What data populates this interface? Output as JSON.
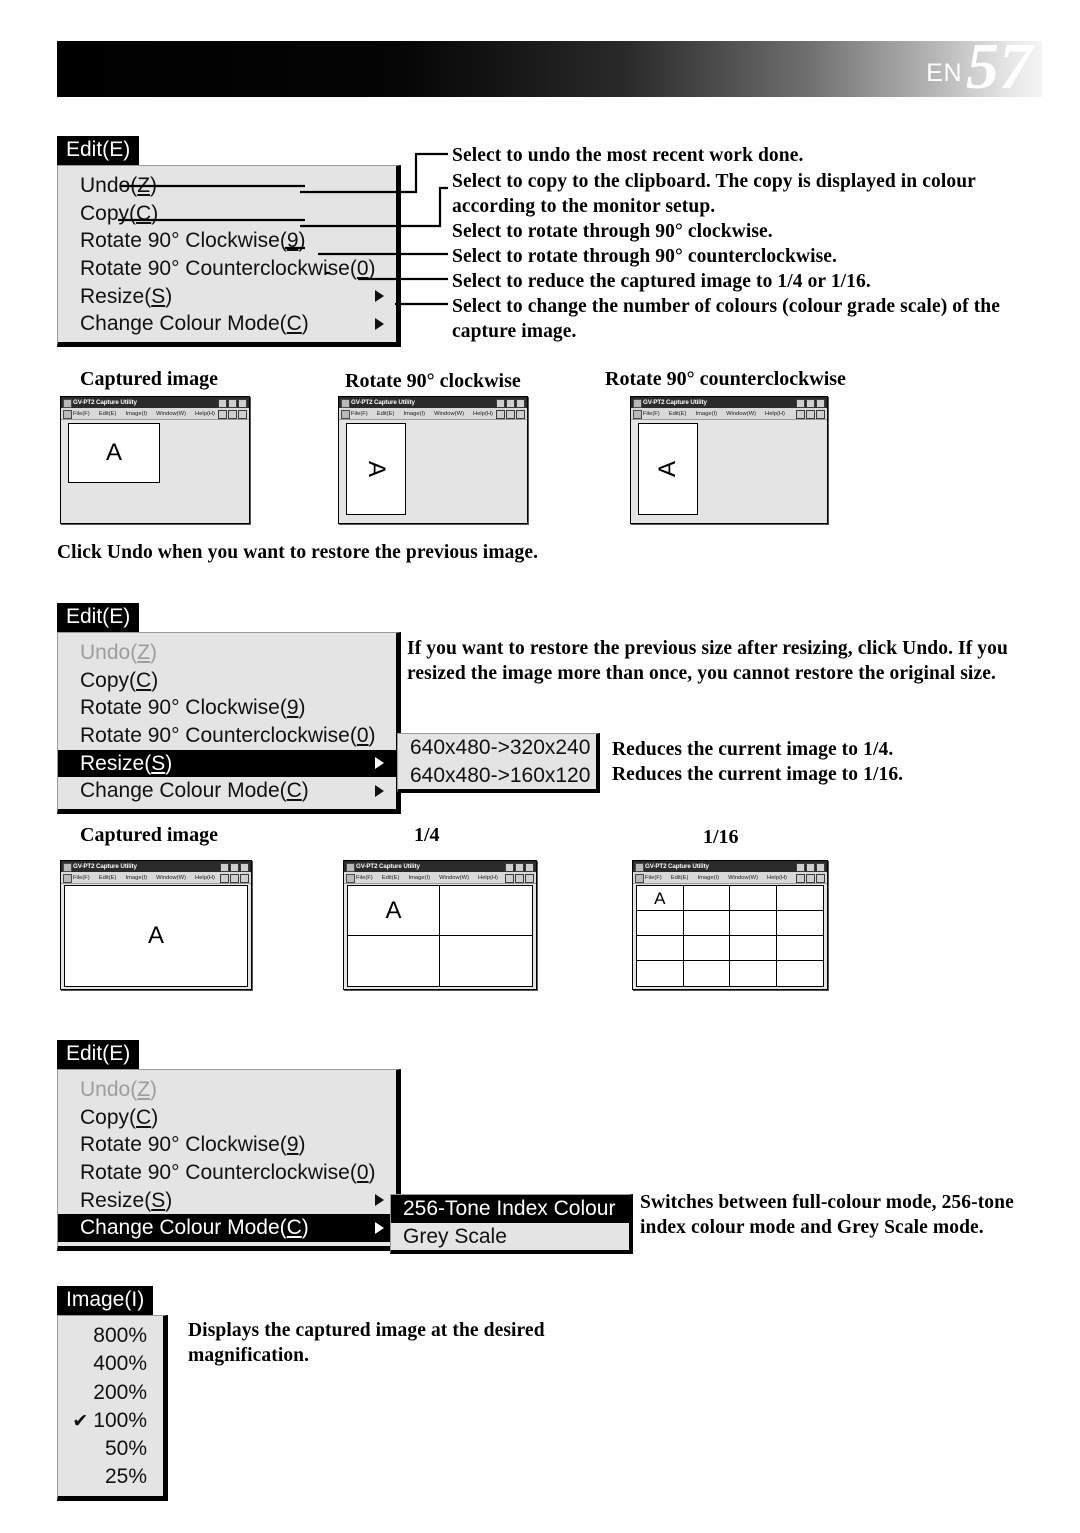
{
  "header": {
    "lang": "EN",
    "page_number": "57"
  },
  "menu1": {
    "title": "Edit(E)",
    "title_mnemonic": "E",
    "items": [
      {
        "label": "Undo(Z)",
        "mnemonic": "Z",
        "disabled": false,
        "selected": false,
        "submenu_arrow": false
      },
      {
        "label": "Copy(C)",
        "mnemonic": "C",
        "disabled": false,
        "selected": false,
        "submenu_arrow": false
      },
      {
        "label": "Rotate 90° Clockwise(9)",
        "mnemonic": "9",
        "disabled": false,
        "selected": false,
        "submenu_arrow": false
      },
      {
        "label": "Rotate 90° Counterclockwise(0)",
        "mnemonic": "0",
        "disabled": false,
        "selected": false,
        "submenu_arrow": false
      },
      {
        "label": "Resize(S)",
        "mnemonic": "S",
        "disabled": false,
        "selected": false,
        "submenu_arrow": true
      },
      {
        "label": "Change Colour Mode(C)",
        "mnemonic": "C",
        "disabled": false,
        "selected": false,
        "submenu_arrow": true
      }
    ],
    "descriptions": [
      "Select to undo the most recent work done.",
      "Select to copy to the clipboard.  The copy is displayed in colour according to the monitor setup.",
      "Select to rotate through 90° clockwise.",
      "Select to rotate through 90° counterclockwise.",
      "Select to reduce the captured image to 1/4 or 1/16.",
      "Select to change the number of colours (colour grade scale) of the capture image."
    ]
  },
  "gallery1": {
    "captions": [
      "Captured image",
      "Rotate 90° clockwise",
      "Rotate 90° counterclockwise"
    ],
    "window": {
      "title": "GV-PT2 Capture Utility",
      "menus": [
        "File(F)",
        "Edit(E)",
        "Image(I)",
        "Window(W)",
        "Help(H)"
      ]
    },
    "glyph": "A"
  },
  "note_undo": "Click Undo when you want to restore the previous image.",
  "menu2": {
    "title": "Edit(E)",
    "title_mnemonic": "E",
    "items": [
      {
        "label": "Undo(Z)",
        "mnemonic": "Z",
        "disabled": true,
        "selected": false,
        "submenu_arrow": false
      },
      {
        "label": "Copy(C)",
        "mnemonic": "C",
        "disabled": false,
        "selected": false,
        "submenu_arrow": false
      },
      {
        "label": "Rotate 90° Clockwise(9)",
        "mnemonic": "9",
        "disabled": false,
        "selected": false,
        "submenu_arrow": false
      },
      {
        "label": "Rotate 90° Counterclockwise(0)",
        "mnemonic": "0",
        "disabled": false,
        "selected": false,
        "submenu_arrow": false
      },
      {
        "label": "Resize(S)",
        "mnemonic": "S",
        "disabled": false,
        "selected": true,
        "submenu_arrow": true
      },
      {
        "label": "Change Colour Mode(C)",
        "mnemonic": "C",
        "disabled": false,
        "selected": false,
        "submenu_arrow": true
      }
    ],
    "submenu": [
      {
        "label": "640x480->320x240",
        "selected": false
      },
      {
        "label": "640x480->160x120",
        "selected": false
      }
    ],
    "description_main": "If you want to restore the previous size after resizing, click Undo. If you resized the image more than once, you cannot restore the original size.",
    "submenu_descriptions": [
      "Reduces the current image to 1/4.",
      "Reduces the current image to 1/16."
    ]
  },
  "gallery2": {
    "captions": [
      "Captured image",
      "1/4",
      "1/16"
    ],
    "window": {
      "title": "GV-PT2 Capture Utility",
      "menus": [
        "File(F)",
        "Edit(E)",
        "Image(I)",
        "Window(W)",
        "Help(H)"
      ]
    },
    "glyph": "A"
  },
  "menu3": {
    "title": "Edit(E)",
    "title_mnemonic": "E",
    "items": [
      {
        "label": "Undo(Z)",
        "mnemonic": "Z",
        "disabled": true,
        "selected": false,
        "submenu_arrow": false
      },
      {
        "label": "Copy(C)",
        "mnemonic": "C",
        "disabled": false,
        "selected": false,
        "submenu_arrow": false
      },
      {
        "label": "Rotate 90° Clockwise(9)",
        "mnemonic": "9",
        "disabled": false,
        "selected": false,
        "submenu_arrow": false
      },
      {
        "label": "Rotate 90° Counterclockwise(0)",
        "mnemonic": "0",
        "disabled": false,
        "selected": false,
        "submenu_arrow": false
      },
      {
        "label": "Resize(S)",
        "mnemonic": "S",
        "disabled": false,
        "selected": false,
        "submenu_arrow": true
      },
      {
        "label": "Change Colour Mode(C)",
        "mnemonic": "C",
        "disabled": false,
        "selected": true,
        "submenu_arrow": true
      }
    ],
    "submenu": [
      {
        "label": "256-Tone Index Colour",
        "selected": true
      },
      {
        "label": "Grey Scale",
        "selected": false
      }
    ],
    "description": "Switches between full-colour mode, 256-tone index colour mode and Grey Scale mode."
  },
  "menu4": {
    "title": "Image(I)",
    "title_mnemonic": "I",
    "items": [
      {
        "label": "800%",
        "checked": false
      },
      {
        "label": "400%",
        "checked": false
      },
      {
        "label": "200%",
        "checked": false
      },
      {
        "label": "100%",
        "checked": true
      },
      {
        "label": "50%",
        "checked": false
      },
      {
        "label": "25%",
        "checked": false
      }
    ],
    "check_glyph": "✔",
    "description": "Displays the captured image at the desired magnification."
  }
}
